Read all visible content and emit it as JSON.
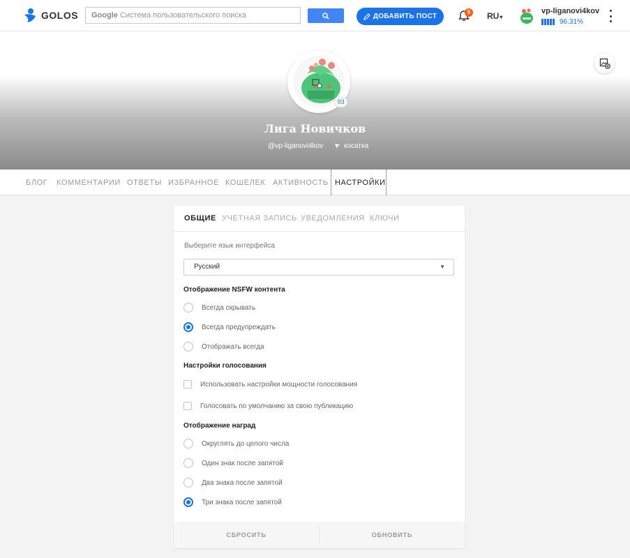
{
  "header": {
    "logo_text": "GOLOS",
    "search_brand": "Google",
    "search_placeholder": "Система пользовательского поиска",
    "add_post_label": "ДОБАВИТЬ ПОСТ",
    "notifications_count": "5",
    "language": "RU",
    "user_name": "vp-liganovi4kov",
    "user_power": "96.31%",
    "colors": {
      "accent": "#1a73e8",
      "search_button": "#4285f4",
      "badge": "#fc5d16"
    }
  },
  "profile": {
    "name": "Лига Новичков",
    "handle": "@vp-liganovi4kov",
    "location": "косатка",
    "rating": "93",
    "avatar_icon": "profile-avatar-image"
  },
  "profile_nav": {
    "items": [
      "БЛОГ",
      "КОММЕНТАРИИ",
      "ОТВЕТЫ",
      "ИЗБРАННОЕ",
      "КОШЕЛЕК",
      "АКТИВНОСТЬ",
      "НАСТРОЙКИ"
    ],
    "active": "НАСТРОЙКИ"
  },
  "settings": {
    "tabs": [
      "ОБЩИЕ",
      "УЧЕТНАЯ ЗАПИСЬ",
      "УВЕДОМЛЕНИЯ",
      "КЛЮЧИ"
    ],
    "active_tab": "ОБЩИЕ",
    "language_label": "Выберите язык интерфейса",
    "language_value": "Русский",
    "nsfw_title": "Отображение NSFW контента",
    "nsfw_options": [
      "Всегда скрывать",
      "Всегда предупреждать",
      "Отображать всегда"
    ],
    "nsfw_selected": "Всегда предупреждать",
    "voting_title": "Настройки голосования",
    "voting_options": [
      "Использовать настройки мощности голосования",
      "Голосовать по умолчанию за свою публикацию"
    ],
    "rewards_title": "Отображение наград",
    "rewards_options": [
      "Округлять до целого числа",
      "Один знак после запятой",
      "Два знака после запятой",
      "Три знака после запятой"
    ],
    "rewards_selected": "Три знака после запятой",
    "reset_label": "СБРОСИТЬ",
    "update_label": "ОБНОВИТЬ"
  }
}
